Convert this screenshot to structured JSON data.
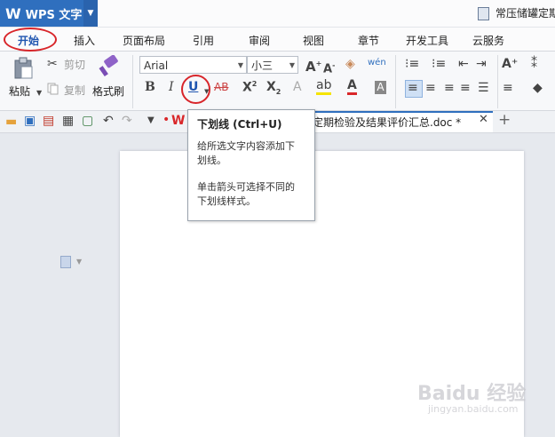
{
  "app": {
    "name": "WPS 文字",
    "logo_glyph": "W"
  },
  "window": {
    "doc_title_trunc": "常压储罐定期"
  },
  "tabs": [
    "开始",
    "插入",
    "页面布局",
    "引用",
    "审阅",
    "视图",
    "章节",
    "开发工具",
    "云服务"
  ],
  "active_tab": "开始",
  "clipboard": {
    "paste": "粘贴",
    "cut": "剪切",
    "copy": "复制",
    "format_painter": "格式刷"
  },
  "font": {
    "family": "Arial",
    "size": "小三"
  },
  "document_tab": {
    "label": "常压储罐定期检验及结果评价汇总.doc *",
    "visible_label": "罐定期检验及结果评价汇总.doc *"
  },
  "tooltip": {
    "title": "下划线 (Ctrl+U)",
    "line1": "给所选文字内容添加下",
    "line2": "划线。",
    "line3": "单击箭头可选择不同的",
    "line4": "下划线样式。"
  },
  "watermark": {
    "text": "Baidu 经验",
    "url": "jingyan.baidu.com"
  },
  "colors": {
    "accent": "#2f6fbe",
    "highlight_ring": "#d8252a",
    "tab_active": "#1f55b0"
  },
  "icons": [
    "wps-logo-icon",
    "paste-icon",
    "cut-icon",
    "copy-icon",
    "format-painter-icon",
    "bold-icon",
    "italic-icon",
    "underline-icon",
    "strikethrough-icon",
    "superscript-icon",
    "subscript-icon",
    "font-color-icon",
    "highlight-icon",
    "align-left-icon",
    "align-center-icon",
    "bullets-icon",
    "numbering-icon",
    "save-icon",
    "undo-icon",
    "redo-icon",
    "close-icon"
  ]
}
